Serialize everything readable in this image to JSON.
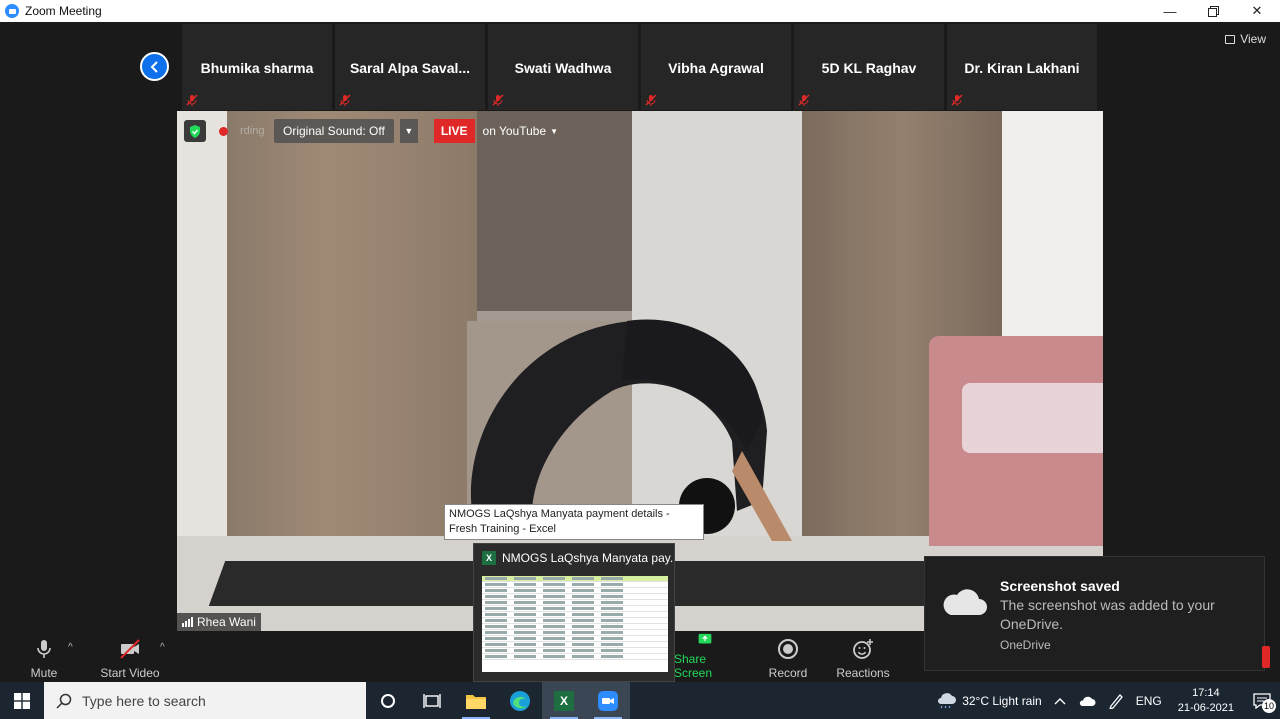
{
  "window": {
    "title": "Zoom Meeting"
  },
  "participants": [
    {
      "name": "Bhumika sharma"
    },
    {
      "name": "Saral  Alpa Saval..."
    },
    {
      "name": "Swati Wadhwa"
    },
    {
      "name": "Vibha Agrawal"
    },
    {
      "name": "5D KL Raghav"
    },
    {
      "name": "Dr. Kiran Lakhani"
    }
  ],
  "view_label": "View",
  "video": {
    "recording_text": "rding",
    "original_sound": "Original Sound: Off",
    "live_label": "LIVE",
    "live_target": "on YouTube",
    "speaker_name": "Rhea Wani"
  },
  "toolbar": {
    "mute": "Mute",
    "start_video": "Start Video",
    "share_screen": "Share Screen",
    "record": "Record",
    "reactions": "Reactions"
  },
  "tooltip": {
    "text": "NMOGS LaQshya Manyata payment details - Fresh Training - Excel"
  },
  "preview": {
    "title": "NMOGS LaQshya Manyata pay..."
  },
  "toast": {
    "title": "Screenshot saved",
    "body": "The screenshot was added to your OneDrive.",
    "source": "OneDrive"
  },
  "taskbar": {
    "search_placeholder": "Type here to search",
    "weather": "32°C  Light rain",
    "language": "ENG",
    "time": "17:14",
    "date": "21-06-2021",
    "notification_count": "10"
  },
  "colors": {
    "zoom_blue": "#0e71eb",
    "live_red": "#e02828",
    "share_green": "#23d959"
  }
}
